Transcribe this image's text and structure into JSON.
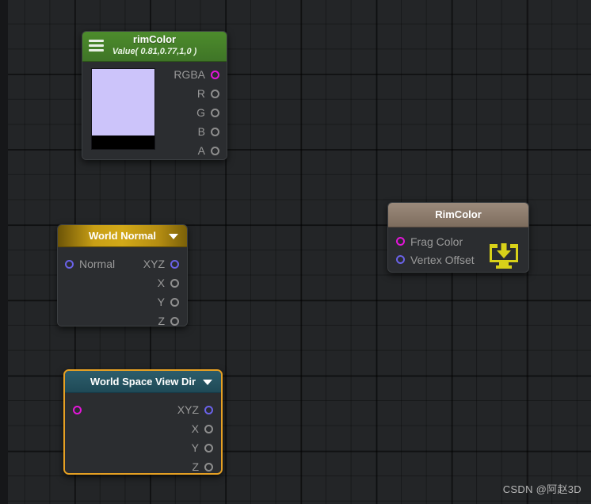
{
  "canvas": {
    "background_color": "#232527",
    "grid_minor_color": "#1b1d1f",
    "grid_major_color": "#101112"
  },
  "nodes": {
    "rim_color_property": {
      "title": "rimColor",
      "subtitle": "Value( 0.81,0.77,1,0 )",
      "header_color": "#4a862a",
      "menu_icon": "hamburger-icon",
      "swatch_color": "#ccc4fa",
      "alpha_color": "#000000",
      "outputs": [
        {
          "label": "RGBA",
          "port_color": "#e316d9",
          "type": "magenta"
        },
        {
          "label": "R",
          "port_color": "#8e8e8e",
          "type": "gray"
        },
        {
          "label": "G",
          "port_color": "#8e8e8e",
          "type": "gray"
        },
        {
          "label": "B",
          "port_color": "#8e8e8e",
          "type": "gray"
        },
        {
          "label": "A",
          "port_color": "#8e8e8e",
          "type": "gray"
        }
      ]
    },
    "world_normal": {
      "title": "World Normal",
      "header_color": "#d2a918",
      "dropdown_icon": "chevron-down-icon",
      "inputs": [
        {
          "label": "Normal",
          "port_color": "#6a62e8",
          "type": "blue"
        }
      ],
      "outputs": [
        {
          "label": "XYZ",
          "port_color": "#6a62e8",
          "type": "blue"
        },
        {
          "label": "X",
          "port_color": "#8e8e8e",
          "type": "gray"
        },
        {
          "label": "Y",
          "port_color": "#8e8e8e",
          "type": "gray"
        },
        {
          "label": "Z",
          "port_color": "#8e8e8e",
          "type": "gray"
        }
      ]
    },
    "world_space_view_dir": {
      "title": "World Space View Dir",
      "header_color": "#24505e",
      "selection_color": "#e6a023",
      "dropdown_icon": "chevron-down-icon",
      "inputs": [
        {
          "label": "",
          "port_color": "#e316d9",
          "type": "magenta"
        }
      ],
      "outputs": [
        {
          "label": "XYZ",
          "port_color": "#6a62e8",
          "type": "blue"
        },
        {
          "label": "X",
          "port_color": "#8e8e8e",
          "type": "gray"
        },
        {
          "label": "Y",
          "port_color": "#8e8e8e",
          "type": "gray"
        },
        {
          "label": "Z",
          "port_color": "#8e8e8e",
          "type": "gray"
        }
      ]
    },
    "rim_color_master": {
      "title": "RimColor",
      "header_color": "#8b7a6b",
      "action_icon": "download-to-monitor-icon",
      "action_icon_color": "#d8d119",
      "inputs": [
        {
          "label": "Frag Color",
          "port_color": "#e316d9",
          "type": "magenta"
        },
        {
          "label": "Vertex Offset",
          "port_color": "#6a62e8",
          "type": "blue"
        }
      ]
    }
  },
  "watermark": {
    "text": "CSDN @阿赵3D"
  }
}
